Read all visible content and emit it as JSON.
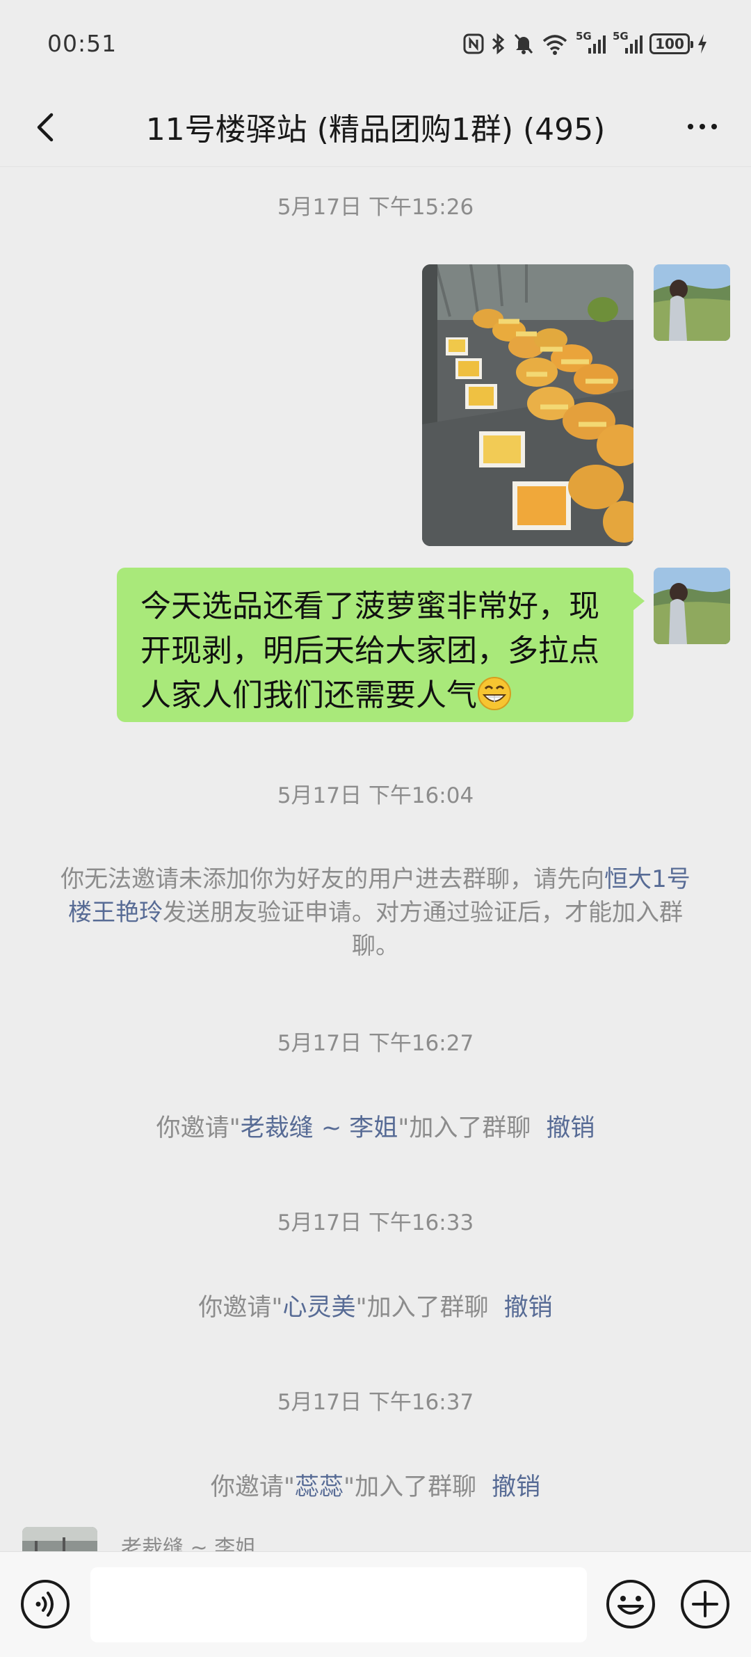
{
  "status_bar": {
    "time": "00:51",
    "signal_label": "5G",
    "battery": "100"
  },
  "nav": {
    "title": "11号楼驿站 (精品团购1群) (495)"
  },
  "messages": {
    "ts1": "5月17日 下午15:26",
    "text_message": "今天选品还看了菠萝蜜非常好，现开现剥，明后天给大家团，多拉点人家人们我们还需要人气",
    "ts2": "5月17日 下午16:04",
    "notice_before": "你无法邀请未添加你为好友的用户进去群聊，请先向",
    "notice_link": "恒大1号楼王艳玲",
    "notice_after": "发送朋友验证申请。对方通过验证后，才能加入群聊。",
    "ts3": "5月17日 下午16:27",
    "invite1_prefix": "你邀请\"",
    "invite1_name": "老裁缝 ~ 李姐",
    "invite1_suffix": "\"加入了群聊",
    "ts4": "5月17日 下午16:33",
    "invite2_prefix": "你邀请\"",
    "invite2_name": "心灵美",
    "invite2_suffix": "\"加入了群聊",
    "ts5": "5月17日 下午16:37",
    "invite3_prefix": "你邀请\"",
    "invite3_name": "蕊蕊",
    "invite3_suffix": "\"加入了群聊",
    "revoke_label": "撤销",
    "partial_sender": "老裁缝 ~ 李姐"
  },
  "input": {
    "placeholder": ""
  },
  "colors": {
    "background": "#ededed",
    "bubble_green": "#a9e97a",
    "link_blue": "#576b95",
    "system_gray": "#8c8c8c"
  },
  "icons": [
    "nfc-icon",
    "bluetooth-icon",
    "mute-icon",
    "wifi-icon",
    "signal-icon",
    "battery-icon",
    "charging-icon",
    "back-icon",
    "more-icon",
    "voice-icon",
    "emoji-icon",
    "plus-icon"
  ]
}
